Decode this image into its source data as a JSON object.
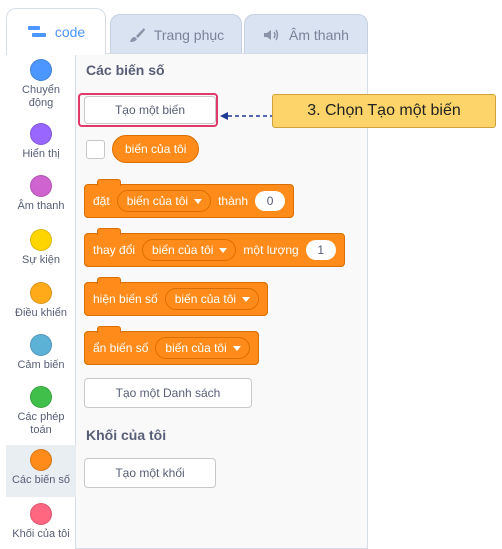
{
  "tabs": [
    {
      "label": "code",
      "icon": "code-icon"
    },
    {
      "label": "Trang phục",
      "icon": "brush-icon"
    },
    {
      "label": "Âm thanh",
      "icon": "speaker-icon"
    }
  ],
  "categories": [
    {
      "label": "Chuyển động",
      "color": "#4c97ff"
    },
    {
      "label": "Hiển thị",
      "color": "#9966ff"
    },
    {
      "label": "Âm thanh",
      "color": "#cf63cf"
    },
    {
      "label": "Sự kiện",
      "color": "#ffd500"
    },
    {
      "label": "Điều khiển",
      "color": "#ffab19"
    },
    {
      "label": "Cảm biến",
      "color": "#5cb1d6"
    },
    {
      "label": "Các phép toán",
      "color": "#40bf4a"
    },
    {
      "label": "Các biến số",
      "color": "#ff8c1a"
    },
    {
      "label": "Khối của tôi",
      "color": "#ff6680"
    }
  ],
  "palette": {
    "variables_heading": "Các biến số",
    "make_variable_label": "Tạo một biến",
    "variable_reporter": "biến của tôi",
    "set_block": {
      "prefix": "đặt",
      "var": "biến của tôi",
      "suffix": "thành",
      "value": "0"
    },
    "change_block": {
      "prefix": "thay đổi",
      "var": "biến của tôi",
      "suffix": "một lượng",
      "value": "1"
    },
    "show_block": {
      "prefix": "hiện biến số",
      "var": "biến của tôi"
    },
    "hide_block": {
      "prefix": "ẩn biến số",
      "var": "biến của tôi"
    },
    "make_list_label": "Tạo một Danh sách",
    "my_blocks_heading": "Khối của tôi",
    "make_block_label": "Tạo một khối"
  },
  "callout": {
    "text": "3. Chọn Tạo một biến"
  },
  "colors": {
    "accent": "#4c97ff",
    "variables": "#ff8c1a",
    "highlight": "#e03a6a",
    "callout": "#fdd46a"
  }
}
